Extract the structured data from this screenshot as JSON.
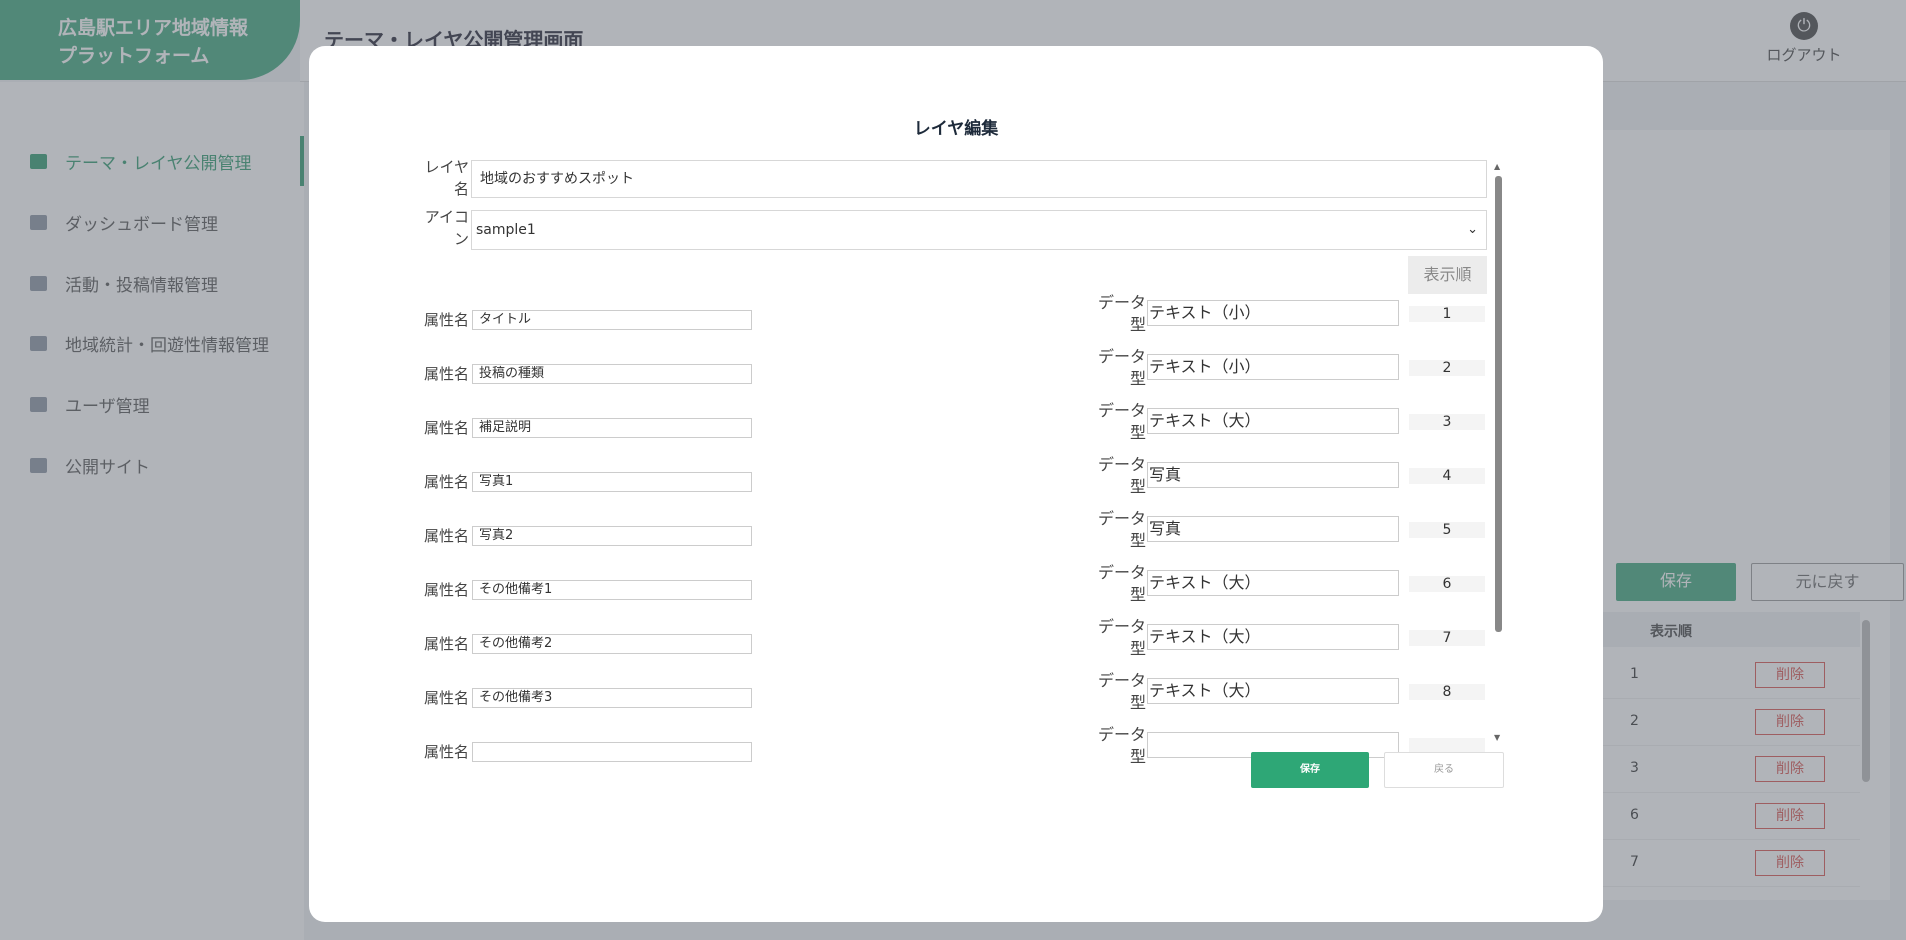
{
  "app": {
    "brand": "広島駅エリア地域情報\nプラットフォーム",
    "page_title": "テーマ・レイヤ公開管理画面",
    "logout_label": "ログアウト",
    "accent_color": "#3fa77d"
  },
  "sidebar": {
    "items": [
      {
        "label": "テーマ・レイヤ公開管理",
        "icon": "map-icon"
      },
      {
        "label": "ダッシュボード管理",
        "icon": "dashboard-icon"
      },
      {
        "label": "活動・投稿情報管理",
        "icon": "briefcase-icon"
      },
      {
        "label": "地域統計・回遊性情報管理",
        "icon": "stats-icon"
      },
      {
        "label": "ユーザ管理",
        "icon": "user-icon"
      },
      {
        "label": "公開サイト",
        "icon": "monitor-icon"
      }
    ]
  },
  "background": {
    "save_label": "保存",
    "revert_label": "元に戻す",
    "order_header": "表示順",
    "delete_label": "削除",
    "rows": [
      "1",
      "2",
      "3",
      "6",
      "7"
    ]
  },
  "modal": {
    "title": "レイヤ編集",
    "layer_name_label": "レイヤ\n名",
    "layer_name_value": "地域のおすすめスポット",
    "icon_label": "アイコ\nン",
    "icon_value": "sample1",
    "order_header": "表示順",
    "attr_label": "属性名",
    "datatype_label": "データ\n型",
    "attributes": [
      {
        "name": "タイトル",
        "type": "テキスト（小）",
        "order": "1"
      },
      {
        "name": "投稿の種類",
        "type": "テキスト（小）",
        "order": "2"
      },
      {
        "name": "補足説明",
        "type": "テキスト（大）",
        "order": "3"
      },
      {
        "name": "写真1",
        "type": "写真",
        "order": "4"
      },
      {
        "name": "写真2",
        "type": "写真",
        "order": "5"
      },
      {
        "name": "その他備考1",
        "type": "テキスト（大）",
        "order": "6"
      },
      {
        "name": "その他備考2",
        "type": "テキスト（大）",
        "order": "7"
      },
      {
        "name": "その他備考3",
        "type": "テキスト（大）",
        "order": "8"
      },
      {
        "name": "",
        "type": "",
        "order": ""
      }
    ],
    "save_label": "保存",
    "back_label": "戻る",
    "save_color": "#2ea776"
  }
}
